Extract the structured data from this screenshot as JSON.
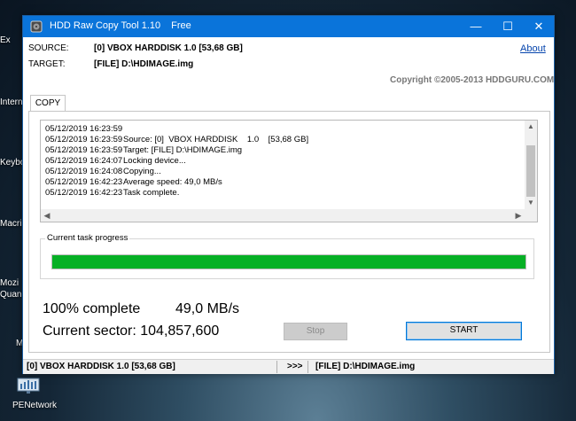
{
  "desktop": {
    "labels": [
      "Ex",
      "Intern",
      "Keybo",
      "Macri",
      "Mozi",
      "Quan",
      "M"
    ],
    "network_icon_label": "PENetwork"
  },
  "window": {
    "title": "HDD Raw Copy Tool 1.10",
    "edition": "Free",
    "controls": {
      "minimize": "—",
      "maximize": "☐",
      "close": "✕"
    }
  },
  "info": {
    "source_label": "SOURCE:",
    "source_value": "[0]  VBOX HARDDISK    1.0    [53,68 GB]",
    "target_label": "TARGET:",
    "target_value": "[FILE] D:\\HDIMAGE.img",
    "about_link": "About",
    "copyright": "Copyright ©2005-2013 HDDGURU.COM"
  },
  "tabs": [
    {
      "label": "COPY",
      "active": true
    }
  ],
  "log": [
    {
      "time": "05/12/2019 16:23:59",
      "message": ""
    },
    {
      "time": "05/12/2019 16:23:59",
      "message": "Source: [0]  VBOX HARDDISK    1.0    [53,68 GB]"
    },
    {
      "time": "05/12/2019 16:23:59",
      "message": "Target: [FILE] D:\\HDIMAGE.img"
    },
    {
      "time": "05/12/2019 16:24:07",
      "message": "Locking device..."
    },
    {
      "time": "05/12/2019 16:24:08",
      "message": "Copying..."
    },
    {
      "time": "05/12/2019 16:42:23",
      "message": "Average speed: 49,0 MB/s"
    },
    {
      "time": "05/12/2019 16:42:23",
      "message": "Task complete."
    }
  ],
  "progress": {
    "group_label": "Current task progress",
    "percent": 100,
    "color": "#06b025"
  },
  "stats": {
    "complete_text": "100% complete",
    "speed_text": "49,0 MB/s",
    "sector_text": "Current sector: 104,857,600"
  },
  "buttons": {
    "stop": "Stop",
    "start": "START"
  },
  "statusbar": {
    "source": "[0]  VBOX HARDDISK    1.0    [53,68 GB]",
    "arrow": ">>>",
    "target": "[FILE] D:\\HDIMAGE.img"
  },
  "colors": {
    "titlebar": "#0a74da",
    "progress": "#06b025",
    "link": "#0645ad"
  }
}
